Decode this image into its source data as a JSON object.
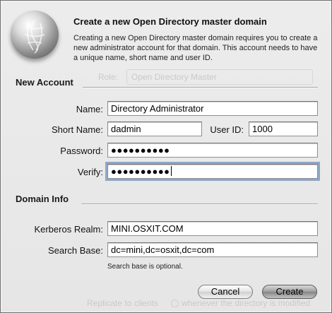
{
  "background_window": {
    "role_label": "Role:",
    "role_value": "Open Directory Master",
    "footer_text": "Replicate to clients",
    "footer_text2": "whenever the directory is modified"
  },
  "dialog": {
    "title": "Create a new Open Directory master domain",
    "description": "Creating a new Open Directory master domain requires you to create a new administrator account for that domain. This account needs to have a unique name, short name and user ID."
  },
  "new_account": {
    "section_label": "New Account",
    "name_label": "Name:",
    "name_value": "Directory Administrator",
    "short_name_label": "Short Name:",
    "short_name_value": "dadmin",
    "user_id_label": "User ID:",
    "user_id_value": "1000",
    "password_label": "Password:",
    "password_value": "●●●●●●●●●●",
    "verify_label": "Verify:",
    "verify_value": "●●●●●●●●●●"
  },
  "domain_info": {
    "section_label": "Domain Info",
    "kerberos_label": "Kerberos Realm:",
    "kerberos_value": "MINI.OSXIT.COM",
    "search_base_label": "Search Base:",
    "search_base_value": "dc=mini,dc=osxit,dc=com",
    "search_base_note": "Search base is optional."
  },
  "buttons": {
    "cancel": "Cancel",
    "create": "Create"
  },
  "icons": {
    "dialog_icon": "directory-globe-icon"
  },
  "colors": {
    "focus_ring": "#8ea7c8",
    "sheet_bg": "#e9e9e9"
  }
}
